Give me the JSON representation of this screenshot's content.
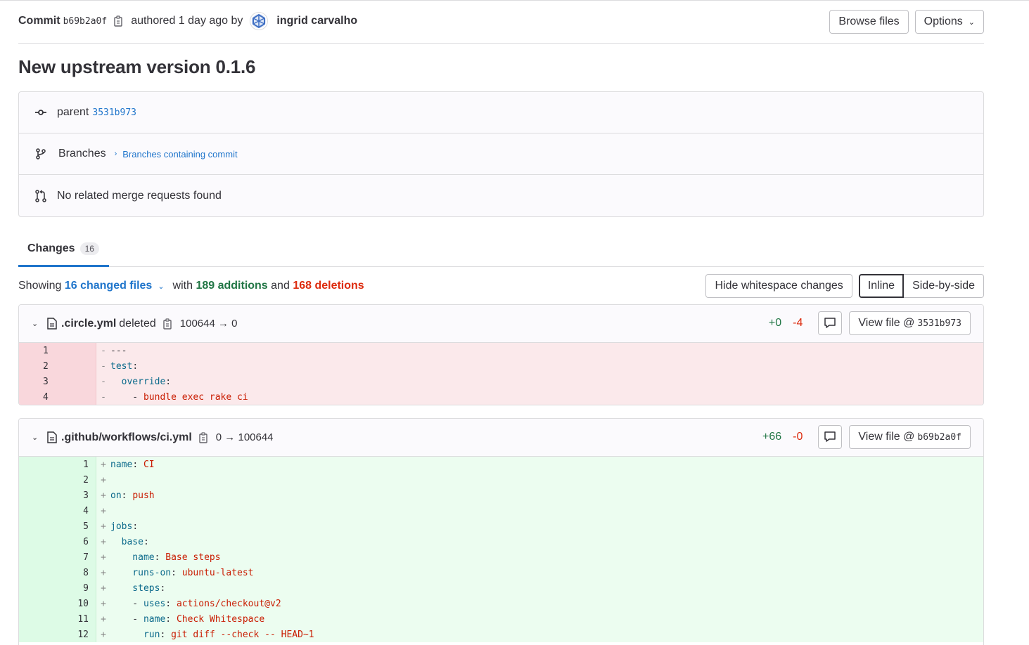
{
  "header": {
    "commit_label": "Commit",
    "sha": "b69b2a0f",
    "authored_text": "authored 1 day ago by",
    "author": "ingrid carvalho",
    "browse_files": "Browse files",
    "options": "Options"
  },
  "title": "New upstream version 0.1.6",
  "info": {
    "parent_label": "parent",
    "parent_sha": "3531b973",
    "branches_label": "Branches",
    "branches_link": "Branches containing commit",
    "merge_requests": "No related merge requests found"
  },
  "tabs": {
    "changes_label": "Changes",
    "changes_count": "16"
  },
  "stats": {
    "showing": "Showing",
    "changed_files": "16 changed files",
    "with": "with",
    "additions": "189 additions",
    "and": "and",
    "deletions": "168 deletions",
    "hide_whitespace": "Hide whitespace changes",
    "inline": "Inline",
    "side_by_side": "Side-by-side"
  },
  "files": [
    {
      "name": ".circle.yml",
      "status": "deleted",
      "mode": "100644 → 0",
      "added": "+0",
      "removed": "-4",
      "view_file": "View file @",
      "view_sha": "3531b973",
      "lines": [
        {
          "n": "1",
          "sign": "-",
          "tokens": [
            {
              "t": "---",
              "c": "p"
            }
          ]
        },
        {
          "n": "2",
          "sign": "-",
          "tokens": [
            {
              "t": "test",
              "c": "k"
            },
            {
              "t": ":",
              "c": "p"
            }
          ]
        },
        {
          "n": "3",
          "sign": "-",
          "tokens": [
            {
              "t": "  override",
              "c": "k"
            },
            {
              "t": ":",
              "c": "p"
            }
          ]
        },
        {
          "n": "4",
          "sign": "-",
          "tokens": [
            {
              "t": "    - ",
              "c": "p"
            },
            {
              "t": "bundle exec rake ci",
              "c": "s"
            }
          ]
        }
      ]
    },
    {
      "name": ".github/workflows/ci.yml",
      "status": "",
      "mode": "0 → 100644",
      "added": "+66",
      "removed": "-0",
      "view_file": "View file @",
      "view_sha": "b69b2a0f",
      "lines": [
        {
          "n": "1",
          "sign": "+",
          "tokens": [
            {
              "t": "name",
              "c": "k"
            },
            {
              "t": ": ",
              "c": "p"
            },
            {
              "t": "CI",
              "c": "s"
            }
          ]
        },
        {
          "n": "2",
          "sign": "+",
          "tokens": []
        },
        {
          "n": "3",
          "sign": "+",
          "tokens": [
            {
              "t": "on",
              "c": "k"
            },
            {
              "t": ": ",
              "c": "p"
            },
            {
              "t": "push",
              "c": "s"
            }
          ]
        },
        {
          "n": "4",
          "sign": "+",
          "tokens": []
        },
        {
          "n": "5",
          "sign": "+",
          "tokens": [
            {
              "t": "jobs",
              "c": "k"
            },
            {
              "t": ":",
              "c": "p"
            }
          ]
        },
        {
          "n": "6",
          "sign": "+",
          "tokens": [
            {
              "t": "  base",
              "c": "k"
            },
            {
              "t": ":",
              "c": "p"
            }
          ]
        },
        {
          "n": "7",
          "sign": "+",
          "tokens": [
            {
              "t": "    name",
              "c": "k"
            },
            {
              "t": ": ",
              "c": "p"
            },
            {
              "t": "Base steps",
              "c": "s"
            }
          ]
        },
        {
          "n": "8",
          "sign": "+",
          "tokens": [
            {
              "t": "    runs-on",
              "c": "k"
            },
            {
              "t": ": ",
              "c": "p"
            },
            {
              "t": "ubuntu-latest",
              "c": "s"
            }
          ]
        },
        {
          "n": "9",
          "sign": "+",
          "tokens": [
            {
              "t": "    steps",
              "c": "k"
            },
            {
              "t": ":",
              "c": "p"
            }
          ]
        },
        {
          "n": "10",
          "sign": "+",
          "tokens": [
            {
              "t": "    - ",
              "c": "p"
            },
            {
              "t": "uses",
              "c": "k"
            },
            {
              "t": ": ",
              "c": "p"
            },
            {
              "t": "actions/checkout@v2",
              "c": "s"
            }
          ]
        },
        {
          "n": "11",
          "sign": "+",
          "tokens": [
            {
              "t": "    - ",
              "c": "p"
            },
            {
              "t": "name",
              "c": "k"
            },
            {
              "t": ": ",
              "c": "p"
            },
            {
              "t": "Check Whitespace",
              "c": "s"
            }
          ]
        },
        {
          "n": "12",
          "sign": "+",
          "tokens": [
            {
              "t": "      run",
              "c": "k"
            },
            {
              "t": ": ",
              "c": "p"
            },
            {
              "t": "git diff --check -- HEAD~1",
              "c": "s"
            }
          ]
        }
      ]
    }
  ]
}
